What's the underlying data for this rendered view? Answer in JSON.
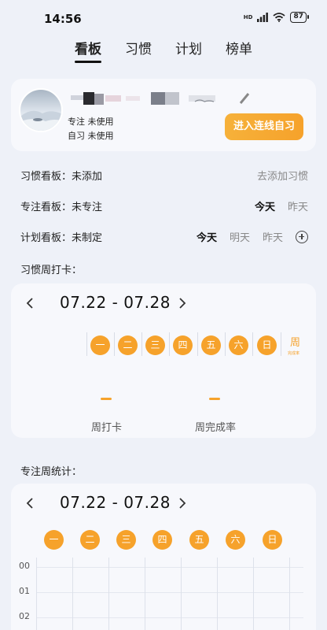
{
  "status_bar": {
    "time": "14:56",
    "network": "HD",
    "battery": "87"
  },
  "tabs": [
    {
      "label": "看板",
      "active": true
    },
    {
      "label": "习惯",
      "active": false
    },
    {
      "label": "计划",
      "active": false
    },
    {
      "label": "榜单",
      "active": false
    }
  ],
  "profile": {
    "focus_label": "专注",
    "focus_value": "未使用",
    "study_label": "自习",
    "study_value": "未使用",
    "enter_button": "进入连线自习"
  },
  "boards": {
    "habit": {
      "label": "习惯看板：未添加",
      "action": "去添加习惯"
    },
    "focus": {
      "label": "专注看板：未专注",
      "today": "今天",
      "yesterday": "昨天"
    },
    "plan": {
      "label": "计划看板：未制定",
      "today": "今天",
      "tomorrow": "明天",
      "yesterday": "昨天"
    }
  },
  "habit_week": {
    "title": "习惯周打卡：",
    "range": "07.22 - 07.28",
    "days": [
      "一",
      "二",
      "三",
      "四",
      "五",
      "六",
      "日"
    ],
    "week_label": "周",
    "week_sub": "完成率",
    "checkin_label": "周打卡",
    "completion_label": "周完成率"
  },
  "focus_week": {
    "title": "专注周统计：",
    "range": "07.22 - 07.28",
    "days": [
      "一",
      "二",
      "三",
      "四",
      "五",
      "六",
      "日"
    ],
    "hours": [
      "00",
      "01",
      "02"
    ]
  },
  "colors": {
    "accent": "#f6a22b",
    "background": "#eef1f8",
    "card": "#f7f8fc"
  }
}
